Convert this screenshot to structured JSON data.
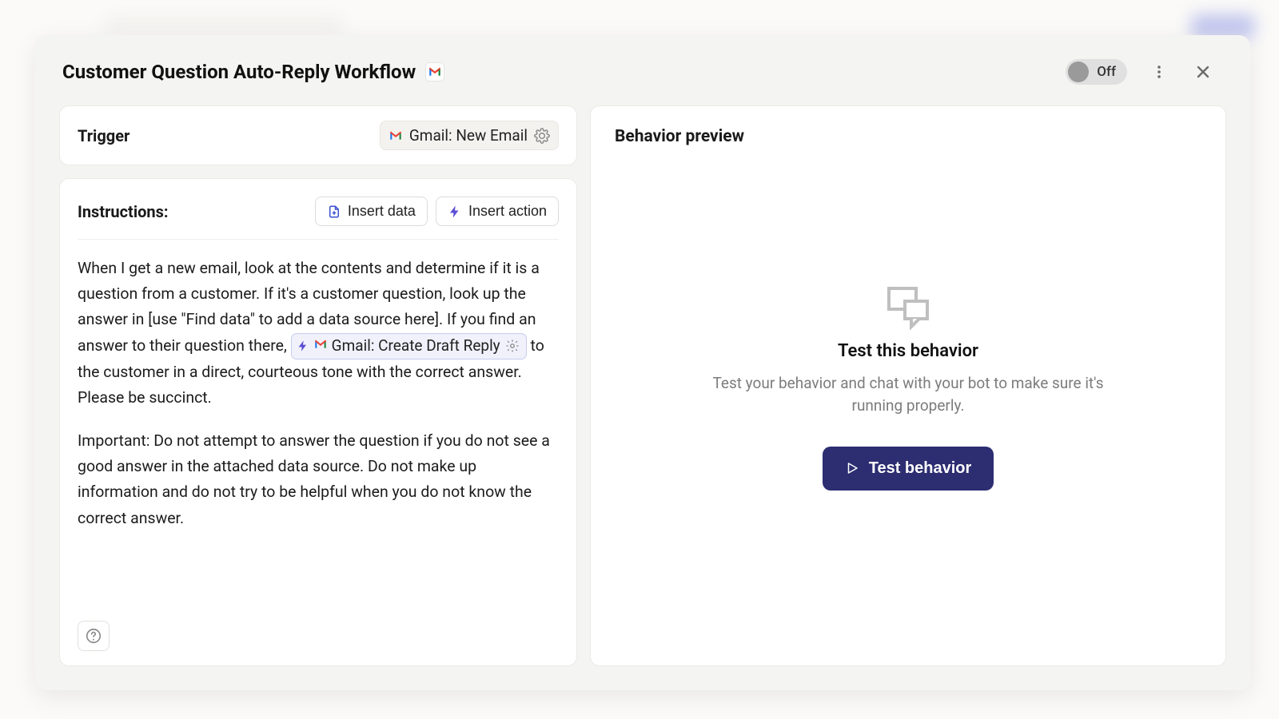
{
  "header": {
    "title": "Customer Question Auto-Reply Workflow",
    "toggle_label": "Off"
  },
  "trigger": {
    "label": "Trigger",
    "pill_text": "Gmail: New Email"
  },
  "instructions": {
    "label": "Instructions:",
    "insert_data_label": "Insert data",
    "insert_action_label": "Insert action",
    "para1_pre": "When I get a new email, look at the contents and determine if it is a question from a customer. If it's a customer question, look up the answer in [use \"Find data\" to add a data source here]. If you find an answer to their question there, ",
    "action_chip": "Gmail: Create Draft Reply",
    "para1_post": " to the customer in a direct, courteous tone with the correct answer. Please be succinct.",
    "para2": "Important: Do not attempt to answer the question if you do not see a good answer in the attached data source. Do not make up information and do not try to be helpful when you do not know the correct answer."
  },
  "preview": {
    "section_title": "Behavior preview",
    "heading": "Test this behavior",
    "sub": "Test your behavior and chat with your bot to make sure it's running properly.",
    "button_label": "Test behavior"
  }
}
